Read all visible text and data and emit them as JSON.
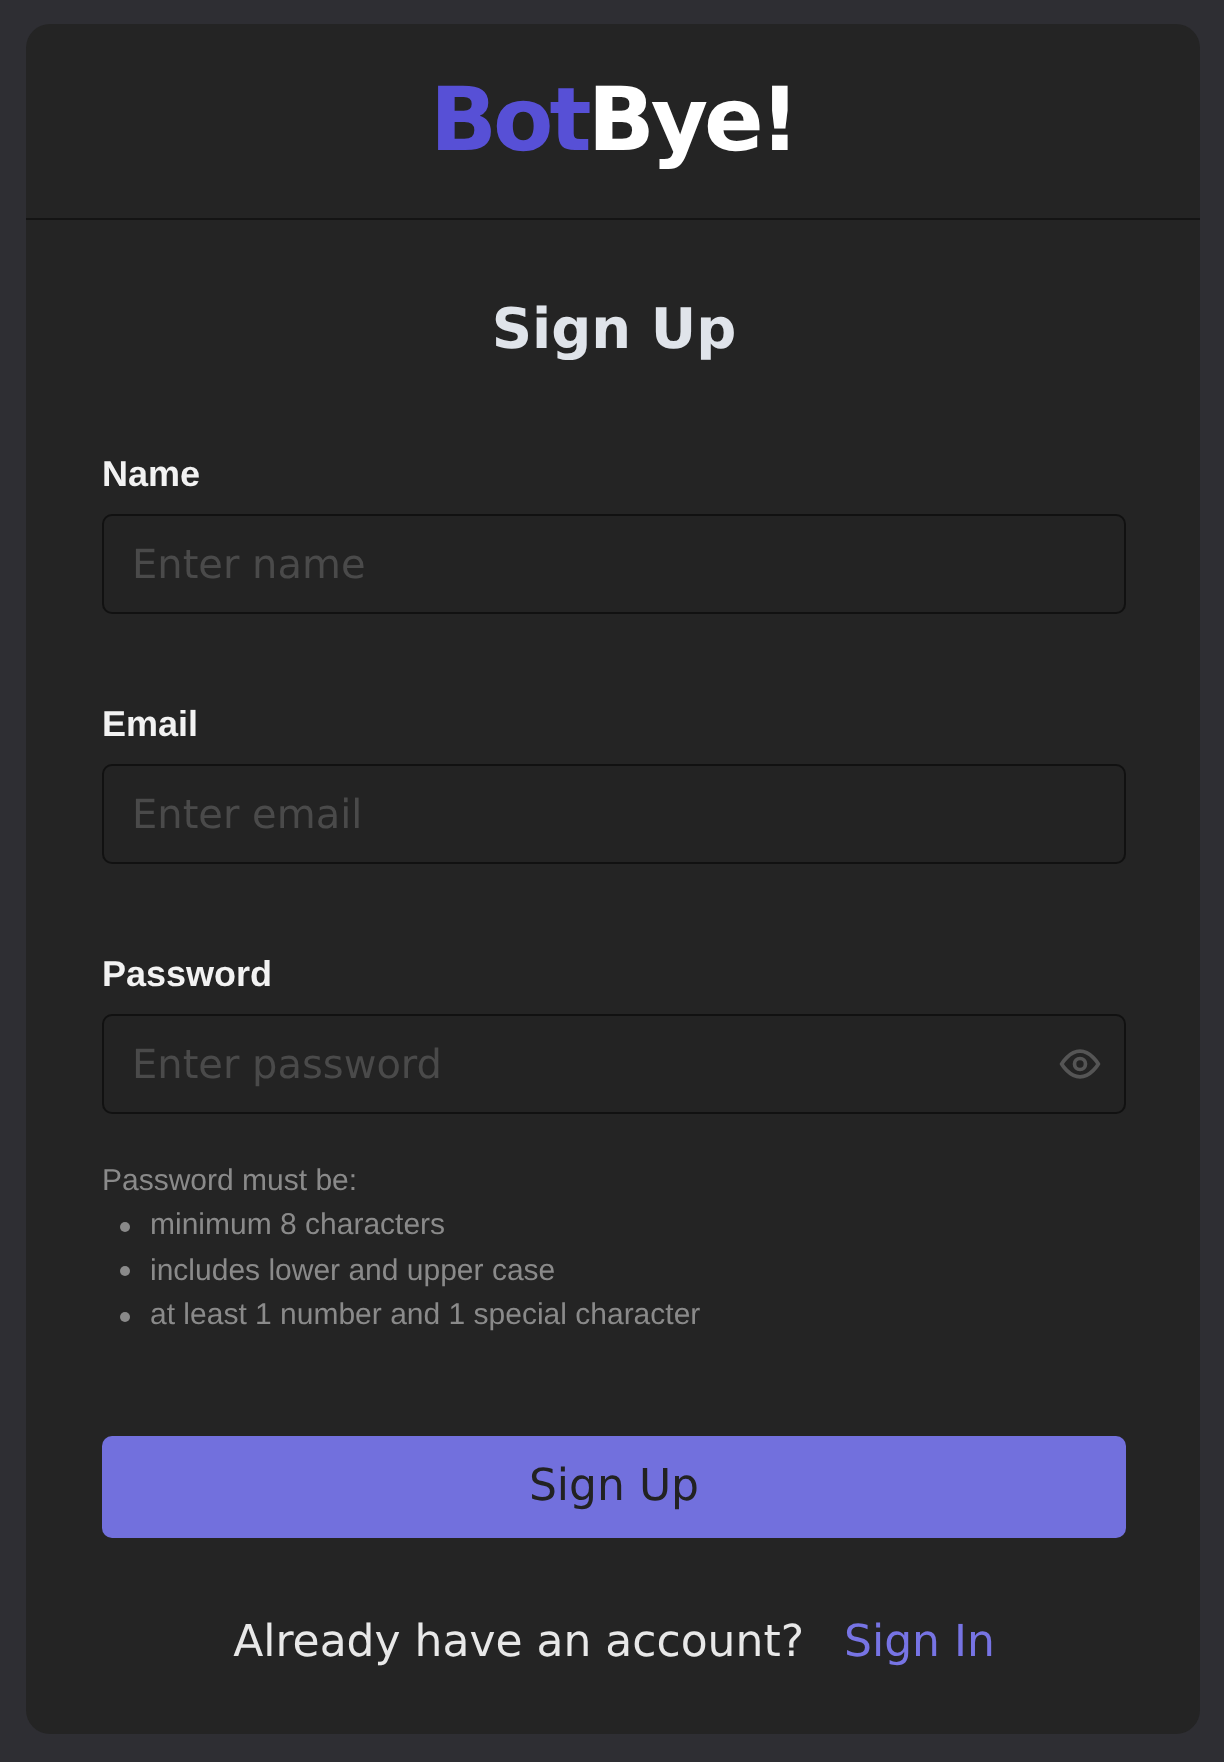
{
  "logo": {
    "parts": [
      {
        "text": "Bot",
        "color": "#5750d6"
      },
      {
        "text": "Bye!",
        "color": "#ffffff"
      }
    ]
  },
  "title": "Sign Up",
  "fields": [
    {
      "label": "Name",
      "placeholder": "Enter name",
      "kind": "text"
    },
    {
      "label": "Email",
      "placeholder": "Enter email",
      "kind": "text"
    },
    {
      "label": "Password",
      "placeholder": "Enter password",
      "kind": "password"
    }
  ],
  "password_hint": {
    "intro": "Password must be:",
    "rules": [
      "minimum 8 characters",
      "includes lower and upper case",
      "at least 1 number and 1 special character"
    ]
  },
  "submit_button": "Sign Up",
  "footer": {
    "text": "Already have an account?",
    "link": "Sign In"
  }
}
